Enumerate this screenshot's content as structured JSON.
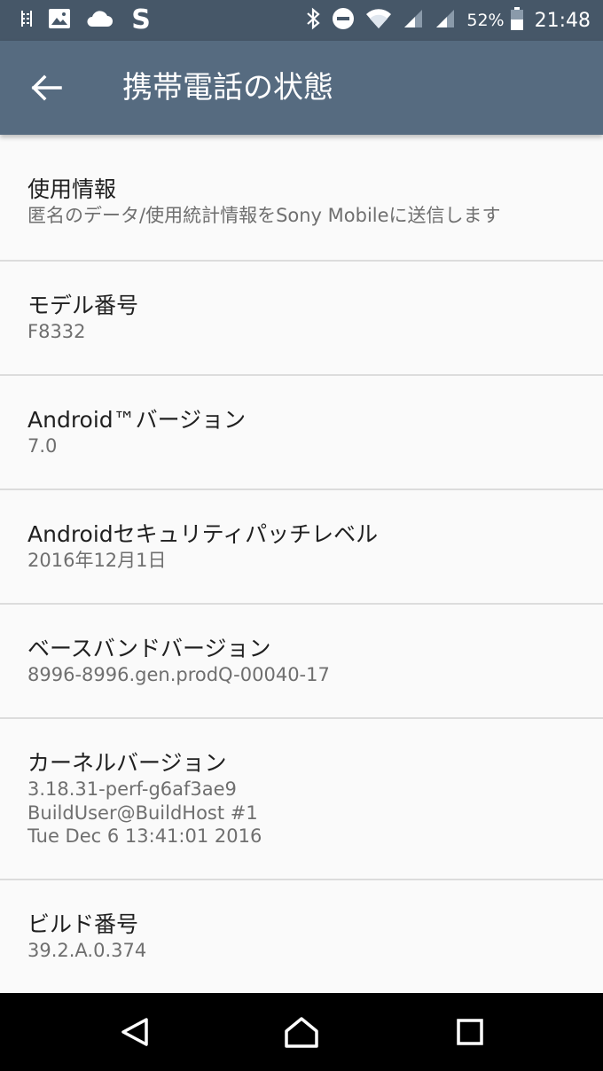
{
  "status_bar": {
    "icons_left": [
      "vibrate-icon",
      "image-icon",
      "cloud-icon",
      "s-app-icon"
    ],
    "icons_right": [
      "bluetooth-icon",
      "do-not-disturb-icon",
      "wifi-icon",
      "signal-icon",
      "signal-icon",
      "battery-icon"
    ],
    "battery": "52%",
    "time": "21:48"
  },
  "app_bar": {
    "back_icon": "arrow-left-icon",
    "title": "携帯電話の状態"
  },
  "items": [
    {
      "title": "使用情報",
      "lines": [
        "匿名のデータ/使用統計情報をSony Mobileに送信します"
      ]
    },
    {
      "title": "モデル番号",
      "lines": [
        "F8332"
      ]
    },
    {
      "title": "Android™バージョン",
      "lines": [
        "7.0"
      ]
    },
    {
      "title": "Androidセキュリティパッチレベル",
      "lines": [
        "2016年12月1日"
      ]
    },
    {
      "title": "ベースバンドバージョン",
      "lines": [
        "8996-8996.gen.prodQ-00040-17"
      ]
    },
    {
      "title": "カーネルバージョン",
      "lines": [
        "3.18.31-perf-g6af3ae9",
        "BuildUser@BuildHost #1",
        "Tue Dec 6 13:41:01 2016"
      ]
    },
    {
      "title": "ビルド番号",
      "lines": [
        "39.2.A.0.374"
      ]
    }
  ],
  "nav_bar": {
    "buttons": [
      "back-triangle-icon",
      "home-icon",
      "recents-icon"
    ]
  }
}
